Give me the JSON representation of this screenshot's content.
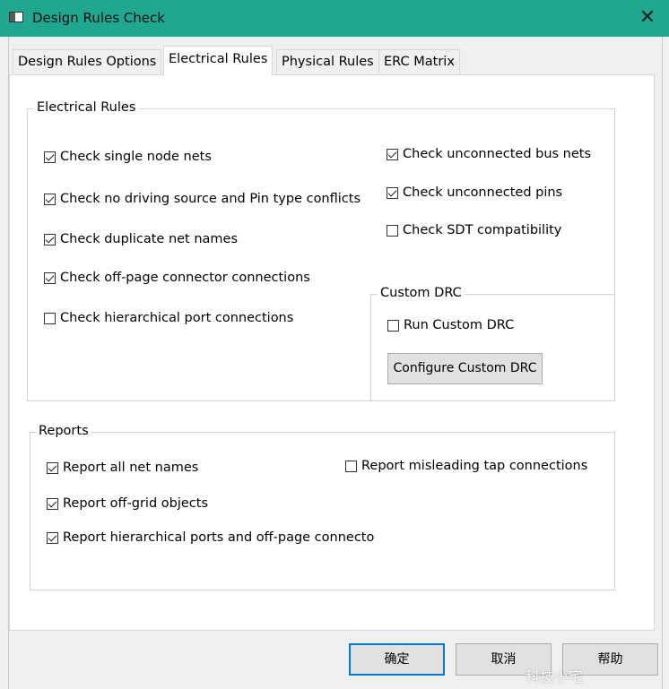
{
  "window": {
    "title": "Design Rules Check",
    "close_icon": "close-icon"
  },
  "tabs": [
    {
      "label": "Design Rules Options",
      "active": false
    },
    {
      "label": "Electrical Rules",
      "active": true
    },
    {
      "label": "Physical Rules",
      "active": false
    },
    {
      "label": "ERC Matrix",
      "active": false
    }
  ],
  "electrical_rules": {
    "group_label": "Electrical Rules",
    "left_checks": [
      {
        "label": "Check single node nets",
        "checked": true
      },
      {
        "label": "Check no driving source and Pin type conflicts",
        "checked": true
      },
      {
        "label": "Check duplicate net names",
        "checked": true
      },
      {
        "label": "Check off-page connector connections",
        "checked": true
      },
      {
        "label": "Check hierarchical port connections",
        "checked": false
      }
    ],
    "right_checks": [
      {
        "label": "Check unconnected bus nets",
        "checked": true
      },
      {
        "label": "Check unconnected pins",
        "checked": true
      },
      {
        "label": "Check SDT compatibility",
        "checked": false
      }
    ],
    "custom_drc": {
      "group_label": "Custom DRC",
      "run_label": "Run Custom DRC",
      "run_checked": false,
      "configure_label": "Configure Custom DRC"
    }
  },
  "reports": {
    "group_label": "Reports",
    "checks": [
      {
        "label": "Report all net names",
        "checked": true
      },
      {
        "label": "Report misleading tap connections",
        "checked": false
      },
      {
        "label": "Report off-grid objects",
        "checked": true
      },
      {
        "label": "Report hierarchical ports and off-page connecto",
        "checked": true
      }
    ]
  },
  "buttons": {
    "ok_label": "确定",
    "cancel_label": "取消",
    "help_label": "帮助"
  },
  "watermark": "科技小宅",
  "colors": {
    "titlebar": "#1fa88f",
    "default_button_border": "#0078d7"
  }
}
